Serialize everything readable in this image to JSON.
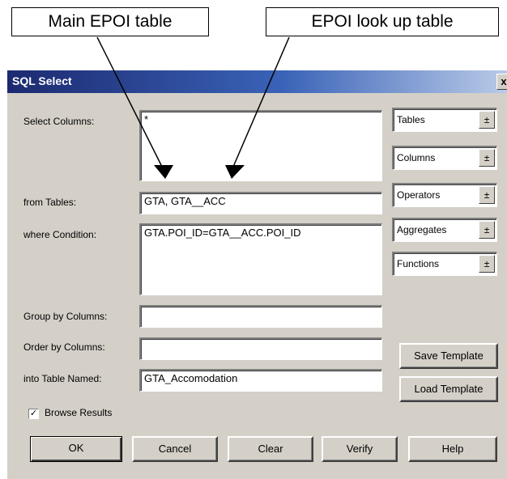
{
  "callouts": {
    "main": "Main EPOI table",
    "lookup": "EPOI look up table"
  },
  "dialog": {
    "title": "SQL Select",
    "close_glyph": "x",
    "labels": {
      "select_columns": "Select Columns:",
      "from_tables": "from Tables:",
      "where_condition": "where Condition:",
      "group_by": "Group by Columns:",
      "order_by": "Order by Columns:",
      "into_table": "into Table Named:"
    },
    "fields": {
      "select_columns": "*",
      "from_tables": "GTA, GTA__ACC",
      "where_condition": "GTA.POI_ID=GTA__ACC.POI_ID",
      "group_by": "",
      "order_by": "",
      "into_table": "GTA_Accomodation"
    },
    "dropdowns": [
      "Tables",
      "Columns",
      "Operators",
      "Aggregates",
      "Functions"
    ],
    "dropdown_glyph": "±",
    "side_buttons": {
      "save": "Save Template",
      "load": "Load Template"
    },
    "browse_results": {
      "label": "Browse Results",
      "checked": true,
      "mark": "✓"
    },
    "buttons": {
      "ok": "OK",
      "cancel": "Cancel",
      "clear": "Clear",
      "verify": "Verify",
      "help": "Help"
    }
  }
}
